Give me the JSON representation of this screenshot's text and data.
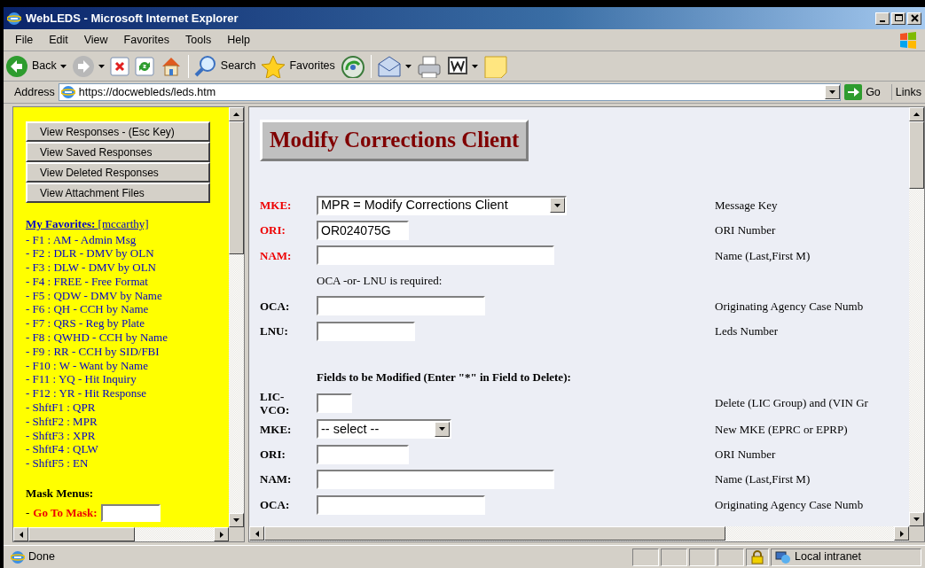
{
  "window": {
    "title": "WebLEDS - Microsoft Internet Explorer"
  },
  "menu": [
    "File",
    "Edit",
    "View",
    "Favorites",
    "Tools",
    "Help"
  ],
  "toolbar": [
    {
      "kind": "back",
      "label": "Back"
    },
    {
      "kind": "forward"
    },
    {
      "kind": "stop"
    },
    {
      "kind": "refresh"
    },
    {
      "kind": "home"
    },
    {
      "kind": "sep"
    },
    {
      "kind": "search",
      "label": "Search"
    },
    {
      "kind": "favorites",
      "label": "Favorites"
    },
    {
      "kind": "media"
    },
    {
      "kind": "sep"
    },
    {
      "kind": "mail"
    },
    {
      "kind": "print"
    },
    {
      "kind": "word"
    },
    {
      "kind": "note"
    }
  ],
  "address": {
    "label": "Address",
    "url": "https://docwebleds/leds.htm",
    "go": "Go",
    "links": "Links"
  },
  "left_frame": {
    "buttons": [
      "View Responses - (Esc Key)",
      "View Saved Responses",
      "View Deleted Responses",
      "View Attachment Files"
    ],
    "favorites_title": "My Favorites:",
    "favorites_user": "[mccarthy]",
    "favorites": [
      "- F1 : AM - Admin Msg",
      "- F2 : DLR - DMV by OLN",
      "- F3 : DLW - DMV by OLN",
      "- F4 : FREE - Free Format",
      "- F5 : QDW - DMV by Name",
      "- F6 : QH - CCH by Name",
      "- F7 : QRS - Reg by Plate",
      "- F8 : QWHD - CCH by Name",
      "- F9 : RR - CCH by SID/FBI",
      "- F10 : W - Want by Name",
      "- F11 : YQ - Hit Inquiry",
      "- F12 : YR - Hit Response",
      "- ShftF1 : QPR",
      "- ShftF2 : MPR",
      "- ShftF3 : XPR",
      "- ShftF4 : QLW",
      "- ShftF5 : EN"
    ],
    "mask_title": "Mask Menus:",
    "mask_dash": "-",
    "mask_label": "Go To Mask:"
  },
  "main": {
    "heading": "Modify Corrections Client",
    "rows": [
      {
        "kind": "select",
        "label": "MKE:",
        "required": true,
        "value": "MPR = Modify Corrections Client",
        "description": "Message Key"
      },
      {
        "kind": "input",
        "label": "ORI:",
        "required": true,
        "value": "OR024075G",
        "description": "ORI Number"
      },
      {
        "kind": "input",
        "label": "NAM:",
        "required": true,
        "description": "Name (Last,First M)"
      },
      {
        "kind": "note",
        "text": "OCA -or- LNU is required:"
      },
      {
        "kind": "input",
        "label": "OCA:",
        "required": false,
        "description": "Originating Agency Case Numb"
      },
      {
        "kind": "input",
        "label": "LNU:",
        "required": false,
        "description": "Leds Number"
      },
      {
        "kind": "section",
        "text": "Fields to be Modified (Enter \"*\" in Field to Delete):"
      },
      {
        "kind": "input",
        "label": "LIC-VCO:",
        "required": false,
        "description": "Delete (LIC Group) and (VIN Gr"
      },
      {
        "kind": "select",
        "label": "MKE:",
        "required": false,
        "value": "-- select --",
        "description": "New MKE (EPRC or EPRP)"
      },
      {
        "kind": "input",
        "label": "ORI:",
        "required": false,
        "description": "ORI Number"
      },
      {
        "kind": "input",
        "label": "NAM:",
        "required": false,
        "description": "Name (Last,First M)"
      },
      {
        "kind": "input",
        "label": "OCA:",
        "required": false,
        "description": "Originating Agency Case Numb"
      }
    ]
  },
  "status_bar": {
    "text": "Done",
    "zone": "Local intranet"
  }
}
